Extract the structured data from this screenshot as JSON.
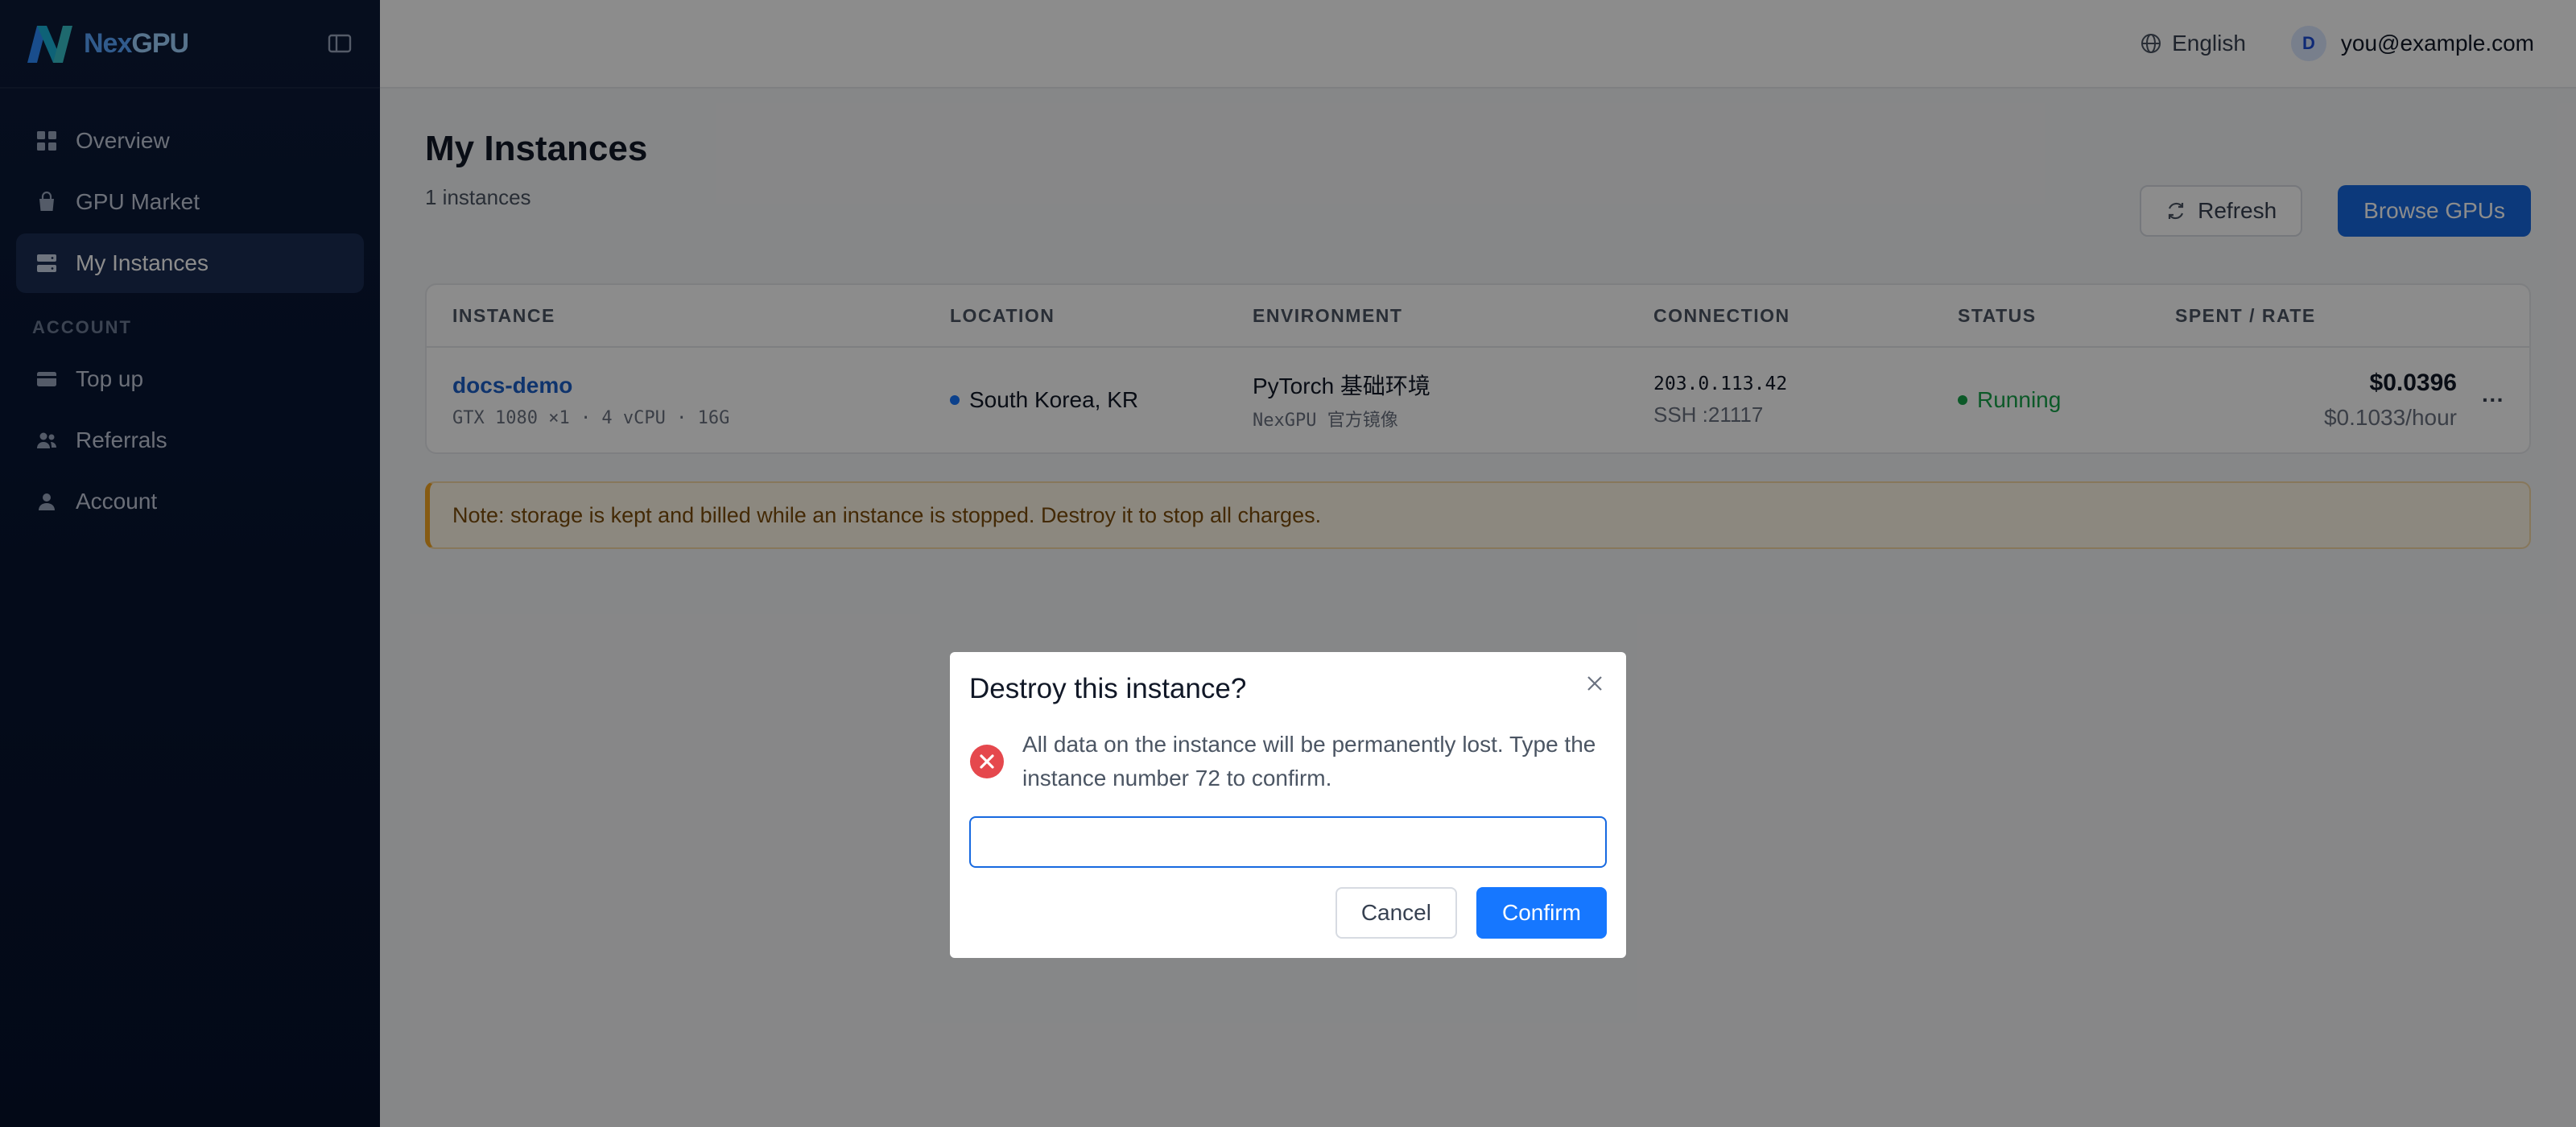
{
  "brand": {
    "name_a": "Nex",
    "name_b": "GPU"
  },
  "colors": {
    "accent": "#1769e0",
    "running": "#16a34a",
    "warning": "#f5a623",
    "error": "#e5484d",
    "location_dot": "#1677ff"
  },
  "sidebar": {
    "items": [
      {
        "label": "Overview",
        "icon": "grid-icon"
      },
      {
        "label": "GPU Market",
        "icon": "bag-icon"
      },
      {
        "label": "My Instances",
        "icon": "server-icon",
        "active": true
      }
    ],
    "section_label": "ACCOUNT",
    "account_items": [
      {
        "label": "Top up",
        "icon": "card-icon"
      },
      {
        "label": "Referrals",
        "icon": "users-icon"
      },
      {
        "label": "Account",
        "icon": "user-icon"
      }
    ]
  },
  "topbar": {
    "language": "English",
    "avatar_initial": "D",
    "email": "you@example.com"
  },
  "page": {
    "title": "My Instances",
    "subtitle": "1 instances",
    "refresh_label": "Refresh",
    "browse_label": "Browse GPUs"
  },
  "table": {
    "headers": [
      "INSTANCE",
      "LOCATION",
      "ENVIRONMENT",
      "CONNECTION",
      "STATUS",
      "SPENT / RATE"
    ],
    "rows": [
      {
        "name": "docs-demo",
        "spec": "GTX 1080 ×1 · 4 vCPU · 16G",
        "location": "South Korea, KR",
        "env_main": "PyTorch 基础环境",
        "env_sub": "NexGPU 官方镜像",
        "ip": "203.0.113.42",
        "ssh": "SSH :21117",
        "status": "Running",
        "spent": "$0.0396",
        "rate": "$0.1033/hour",
        "more": "···"
      }
    ]
  },
  "note": "Note: storage is kept and billed while an instance is stopped. Destroy it to stop all charges.",
  "modal": {
    "title": "Destroy this instance?",
    "message": "All data on the instance will be permanently lost. Type the instance number 72 to confirm.",
    "input_value": "",
    "cancel_label": "Cancel",
    "confirm_label": "Confirm"
  }
}
